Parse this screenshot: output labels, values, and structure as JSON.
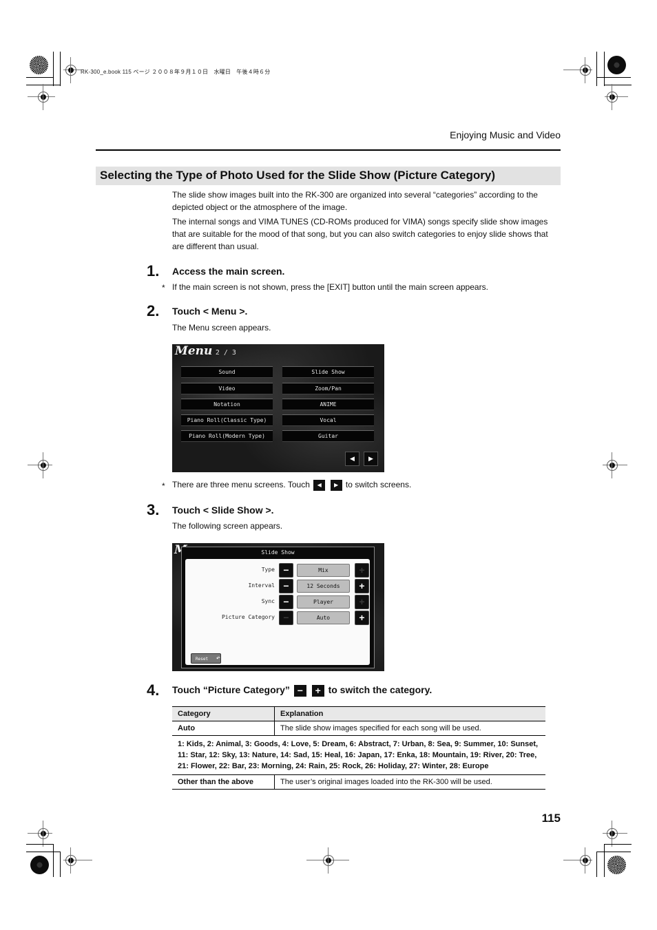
{
  "slug": "RK-300_e.book  115 ページ  ２００８年９月１０日　水曜日　午後４時６分",
  "running_head": "Enjoying Music and Video",
  "section_title": "Selecting the Type of Photo Used for the Slide Show (Picture Category)",
  "intro": [
    "The slide show images built into the RK-300 are organized into several “categories” according to the depicted object or the atmosphere of the image.",
    "The internal songs and VIMA TUNES (CD-ROMs produced for VIMA) songs specify slide show images that are suitable for the mood of that song, but you can also switch categories to enjoy slide shows that are different than usual."
  ],
  "steps": [
    {
      "num": "1.",
      "title": "Access the main screen.",
      "note": "If the main screen is not shown, press the [EXIT] button until the main screen appears."
    },
    {
      "num": "2.",
      "title": "Touch < Menu >.",
      "desc": "The Menu screen appears."
    },
    {
      "num": "3.",
      "title": "Touch < Slide Show >.",
      "desc": "The following screen appears."
    },
    {
      "num": "4.",
      "title_before": "Touch “Picture Category”",
      "title_after": "to switch the category."
    }
  ],
  "star": "*",
  "menu_note": {
    "before": "There are three menu screens. Touch",
    "after": "to switch screens."
  },
  "menu_screen": {
    "title": "Menu",
    "page": "2 / 3",
    "left_buttons": [
      "Sound",
      "Video",
      "Notation",
      "Piano Roll(Classic Type)",
      "Piano Roll(Modern Type)"
    ],
    "right_buttons": [
      "Slide Show",
      "Zoom/Pan",
      "ANIME",
      "Vocal",
      "Guitar"
    ],
    "prev_icon": "◀",
    "next_icon": "▶"
  },
  "slideshow_screen": {
    "bg_letter": "M",
    "title": "Slide Show",
    "rows": [
      {
        "label": "Type",
        "value": "Mix",
        "minus_enabled": true,
        "plus_enabled": false
      },
      {
        "label": "Interval",
        "value": "12 Seconds",
        "minus_enabled": true,
        "plus_enabled": true
      },
      {
        "label": "Sync",
        "value": "Player",
        "minus_enabled": true,
        "plus_enabled": false
      },
      {
        "label": "Picture Category",
        "value": "Auto",
        "minus_enabled": false,
        "plus_enabled": true
      }
    ],
    "minus_glyph": "−",
    "plus_glyph": "+",
    "reset_label": "Reset",
    "reset_icon": "↶"
  },
  "table": {
    "headers": [
      "Category",
      "Explanation"
    ],
    "rows": [
      {
        "category": "Auto",
        "explanation": "The slide show images specified for each song will be used."
      },
      {
        "span": "1: Kids, 2: Animal, 3: Goods, 4: Love, 5: Dream, 6: Abstract, 7: Urban, 8: Sea, 9: Summer, 10: Sunset, 11: Star, 12: Sky, 13: Nature, 14: Sad, 15: Heal, 16: Japan, 17: Enka, 18: Mountain, 19: River, 20: Tree, 21: Flower, 22: Bar, 23: Morning, 24: Rain, 25: Rock, 26: Holiday, 27: Winter, 28: Europe"
      },
      {
        "category": "Other than the above",
        "explanation": "The user’s original images loaded into the RK-300 will be used."
      }
    ]
  },
  "page_number": "115"
}
